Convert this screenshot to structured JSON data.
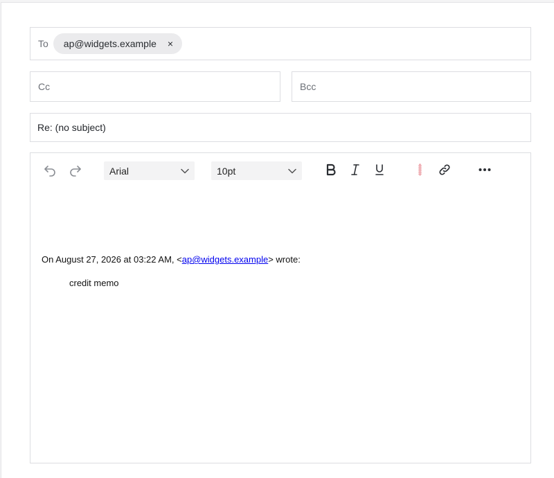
{
  "compose": {
    "to_label": "To",
    "recipients": [
      {
        "email": "ap@widgets.example",
        "remove": "×"
      }
    ],
    "cc_placeholder": "Cc",
    "bcc_placeholder": "Bcc",
    "subject": "Re: (no subject)"
  },
  "toolbar": {
    "font": "Arial",
    "size": "10pt",
    "icons": [
      "undo-icon",
      "redo-icon",
      "bold-icon",
      "italic-icon",
      "underline-icon",
      "text-color-icon",
      "link-icon",
      "more-icon"
    ],
    "accent_color": "#e36a73"
  },
  "body": {
    "quote_header_prefix": "On August 27, 2026 at 03:22 AM, <",
    "quote_email": "ap@widgets.example",
    "quote_header_suffix": "> wrote:",
    "quoted_text": "credit memo"
  }
}
